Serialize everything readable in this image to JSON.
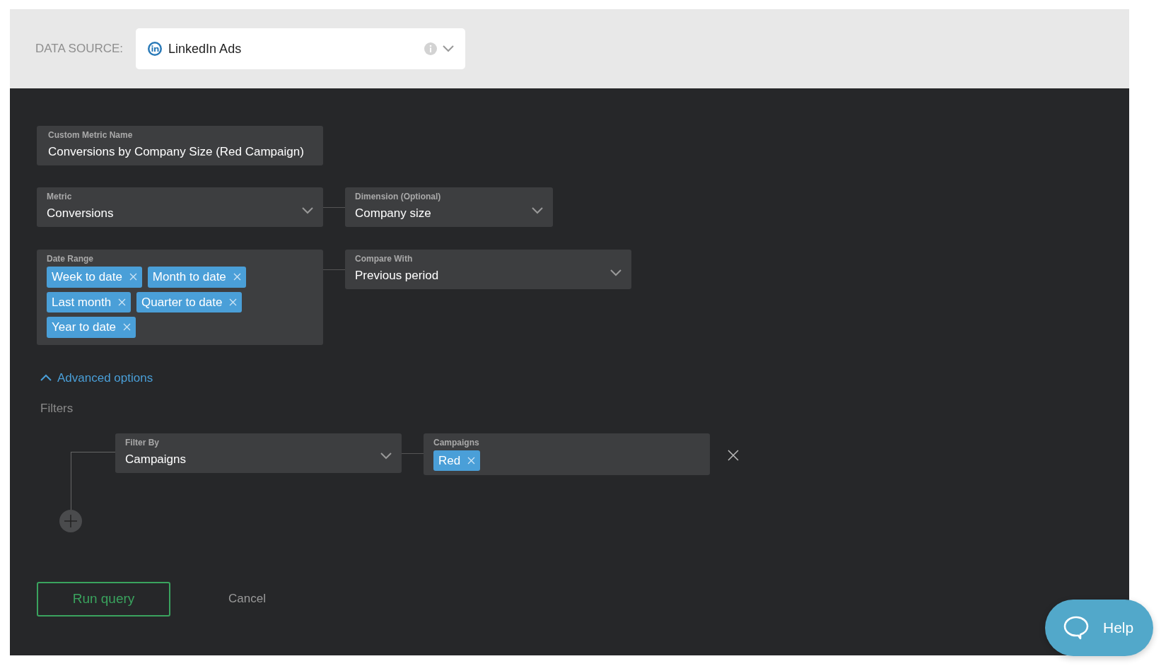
{
  "data_source": {
    "label": "DATA SOURCE:",
    "value": "LinkedIn Ads"
  },
  "custom_metric_name": {
    "label": "Custom Metric Name",
    "value": "Conversions by Company Size (Red Campaign)"
  },
  "metric": {
    "label": "Metric",
    "value": "Conversions"
  },
  "dimension": {
    "label": "Dimension (Optional)",
    "value": "Company size"
  },
  "date_range": {
    "label": "Date Range",
    "tags": [
      "Week to date",
      "Month to date",
      "Last month",
      "Quarter to date",
      "Year to date"
    ]
  },
  "compare_with": {
    "label": "Compare With",
    "value": "Previous period"
  },
  "advanced_options": {
    "label": "Advanced options",
    "expanded": true
  },
  "filters": {
    "label": "Filters",
    "rows": [
      {
        "filter_by": {
          "label": "Filter By",
          "value": "Campaigns"
        },
        "values": {
          "label": "Campaigns",
          "tags": [
            "Red"
          ]
        }
      }
    ]
  },
  "buttons": [
    {
      "label": "Run query",
      "kind": "primary"
    },
    {
      "label": "Cancel",
      "kind": "link"
    }
  ],
  "help": {
    "label": "Help"
  }
}
